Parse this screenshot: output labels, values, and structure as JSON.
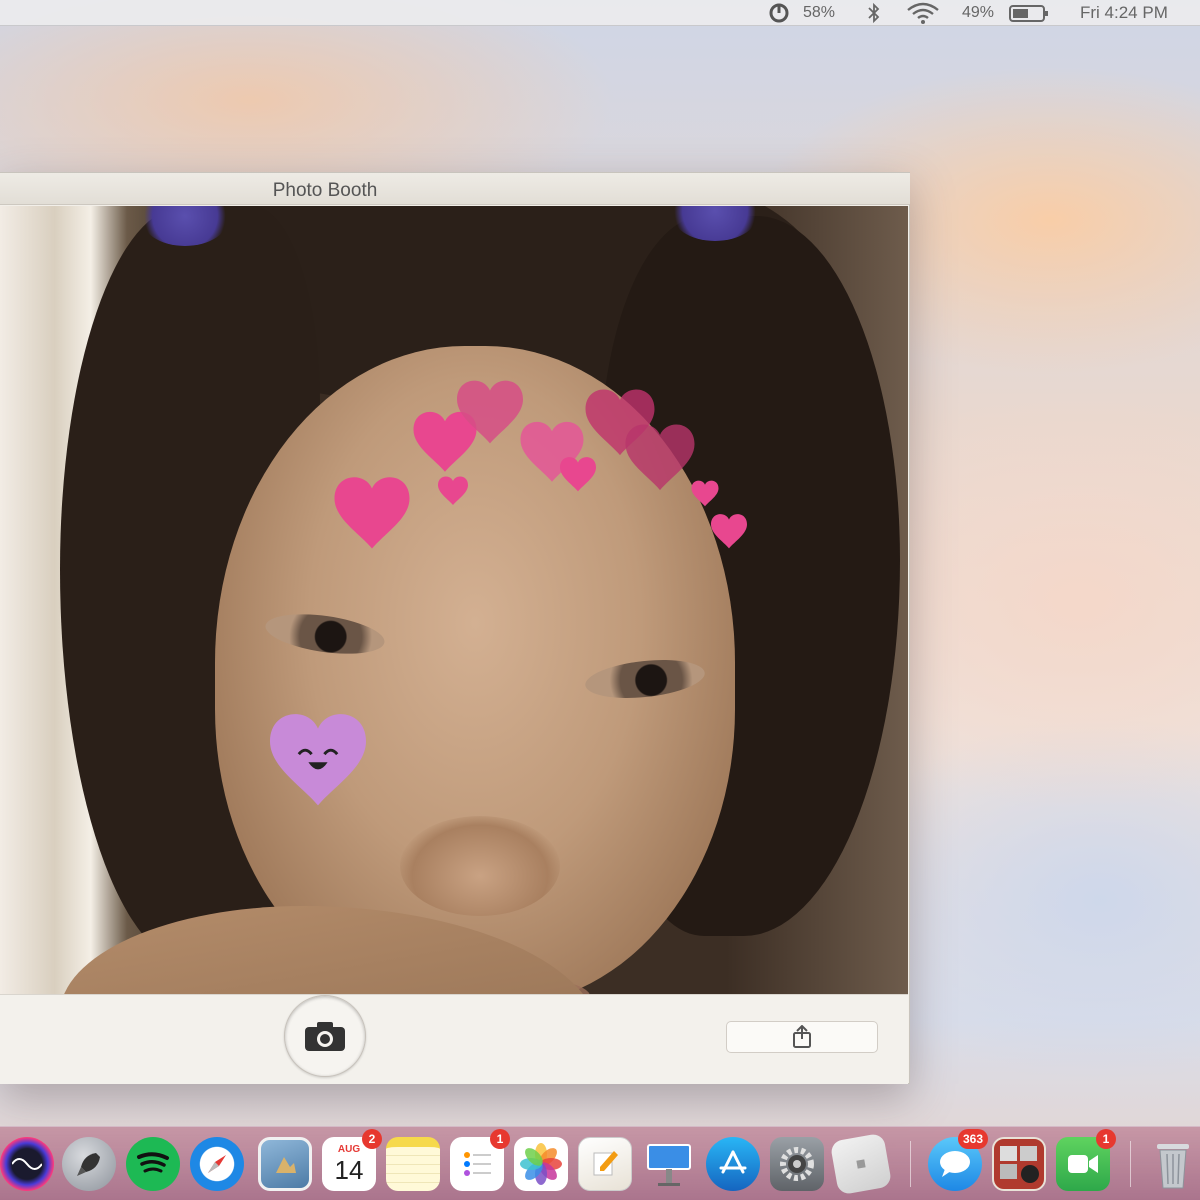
{
  "menubar": {
    "control_center_percent": "58%",
    "battery_percent": "49%",
    "clock": "Fri 4:24 PM"
  },
  "window": {
    "title": "Photo Booth"
  },
  "dock": {
    "items": [
      {
        "name": "Siri",
        "icon": "siri-icon"
      },
      {
        "name": "Launchpad",
        "icon": "rocket-icon"
      },
      {
        "name": "Spotify",
        "icon": "spotify-icon"
      },
      {
        "name": "Safari",
        "icon": "compass-icon"
      },
      {
        "name": "Preview",
        "icon": "preview-icon"
      },
      {
        "name": "Calendar",
        "icon": "calendar-icon",
        "month": "AUG",
        "day": "14",
        "badge": "2"
      },
      {
        "name": "Notes",
        "icon": "notes-icon"
      },
      {
        "name": "Reminders",
        "icon": "reminders-icon",
        "badge": "1"
      },
      {
        "name": "Photos",
        "icon": "photos-icon"
      },
      {
        "name": "Pages",
        "icon": "pages-icon"
      },
      {
        "name": "Keynote",
        "icon": "keynote-icon"
      },
      {
        "name": "App Store",
        "icon": "app-store-icon"
      },
      {
        "name": "System Preferences",
        "icon": "gear-icon"
      },
      {
        "name": "Roblox",
        "icon": "roblox-icon"
      },
      {
        "name": "Messages",
        "icon": "messages-icon",
        "badge": "363"
      },
      {
        "name": "Photo Booth",
        "icon": "photo-booth-icon"
      },
      {
        "name": "FaceTime",
        "icon": "facetime-icon",
        "badge": "1"
      },
      {
        "name": "Trash",
        "icon": "trash-icon"
      }
    ]
  },
  "colors": {
    "badge": "#e7382f",
    "heart_pink": "#e8478f",
    "heart_dark": "#c0326d",
    "heart_lavender": "#c88ad8",
    "spotify": "#1db954"
  }
}
